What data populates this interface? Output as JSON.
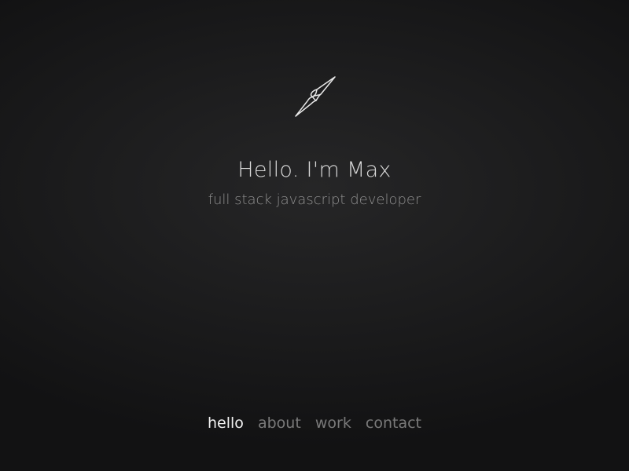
{
  "logo": {
    "icon": "compass-needle-icon",
    "stroke_color": "#e8e8e8"
  },
  "hero": {
    "title": "Hello. I'm Max",
    "subtitle": "full stack javascript developer"
  },
  "nav": {
    "items": [
      {
        "label": "hello",
        "active": true
      },
      {
        "label": "about",
        "active": false
      },
      {
        "label": "work",
        "active": false
      },
      {
        "label": "contact",
        "active": false
      }
    ]
  },
  "colors": {
    "background": "#1d1d1e",
    "text_primary": "#d9d9d9",
    "text_secondary": "#8f8f8f",
    "nav_inactive": "#7a7a7a",
    "nav_active": "#f2f2f2"
  }
}
